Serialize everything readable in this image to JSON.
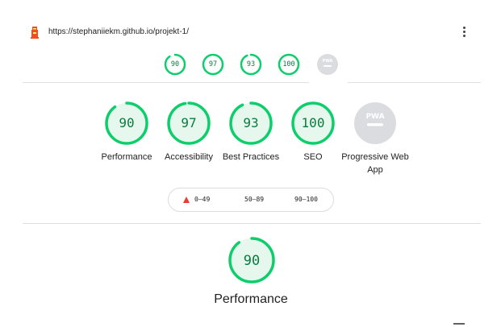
{
  "header": {
    "url": "https://stephaniiekm.github.io/projekt-1/",
    "logo_icon": "lighthouse-icon",
    "menu_icon": "kebab-menu-icon"
  },
  "sticky_scores": [
    {
      "score": "90",
      "fraction": 0.9
    },
    {
      "score": "97",
      "fraction": 0.97
    },
    {
      "score": "93",
      "fraction": 0.93
    },
    {
      "score": "100",
      "fraction": 1.0
    }
  ],
  "categories": [
    {
      "score": "90",
      "fraction": 0.9,
      "label": "Performance"
    },
    {
      "score": "97",
      "fraction": 0.97,
      "label": "Accessibility"
    },
    {
      "score": "93",
      "fraction": 0.93,
      "label": "Best Practices"
    },
    {
      "score": "100",
      "fraction": 1.0,
      "label": "SEO"
    },
    {
      "label": "Progressive Web App",
      "badge": "PWA"
    }
  ],
  "legend": {
    "fail": "0–49",
    "average": "50–89",
    "pass": "90–100"
  },
  "performance": {
    "score": "90",
    "fraction": 0.9,
    "title": "Performance"
  },
  "colors": {
    "pass": "#0cce6b",
    "pass_fill": "#e6f8ee",
    "pass_text": "#0c7a3e",
    "fail": "#eb3b2e",
    "average": "#ffa400",
    "pwa_gray": "#dadce0"
  }
}
